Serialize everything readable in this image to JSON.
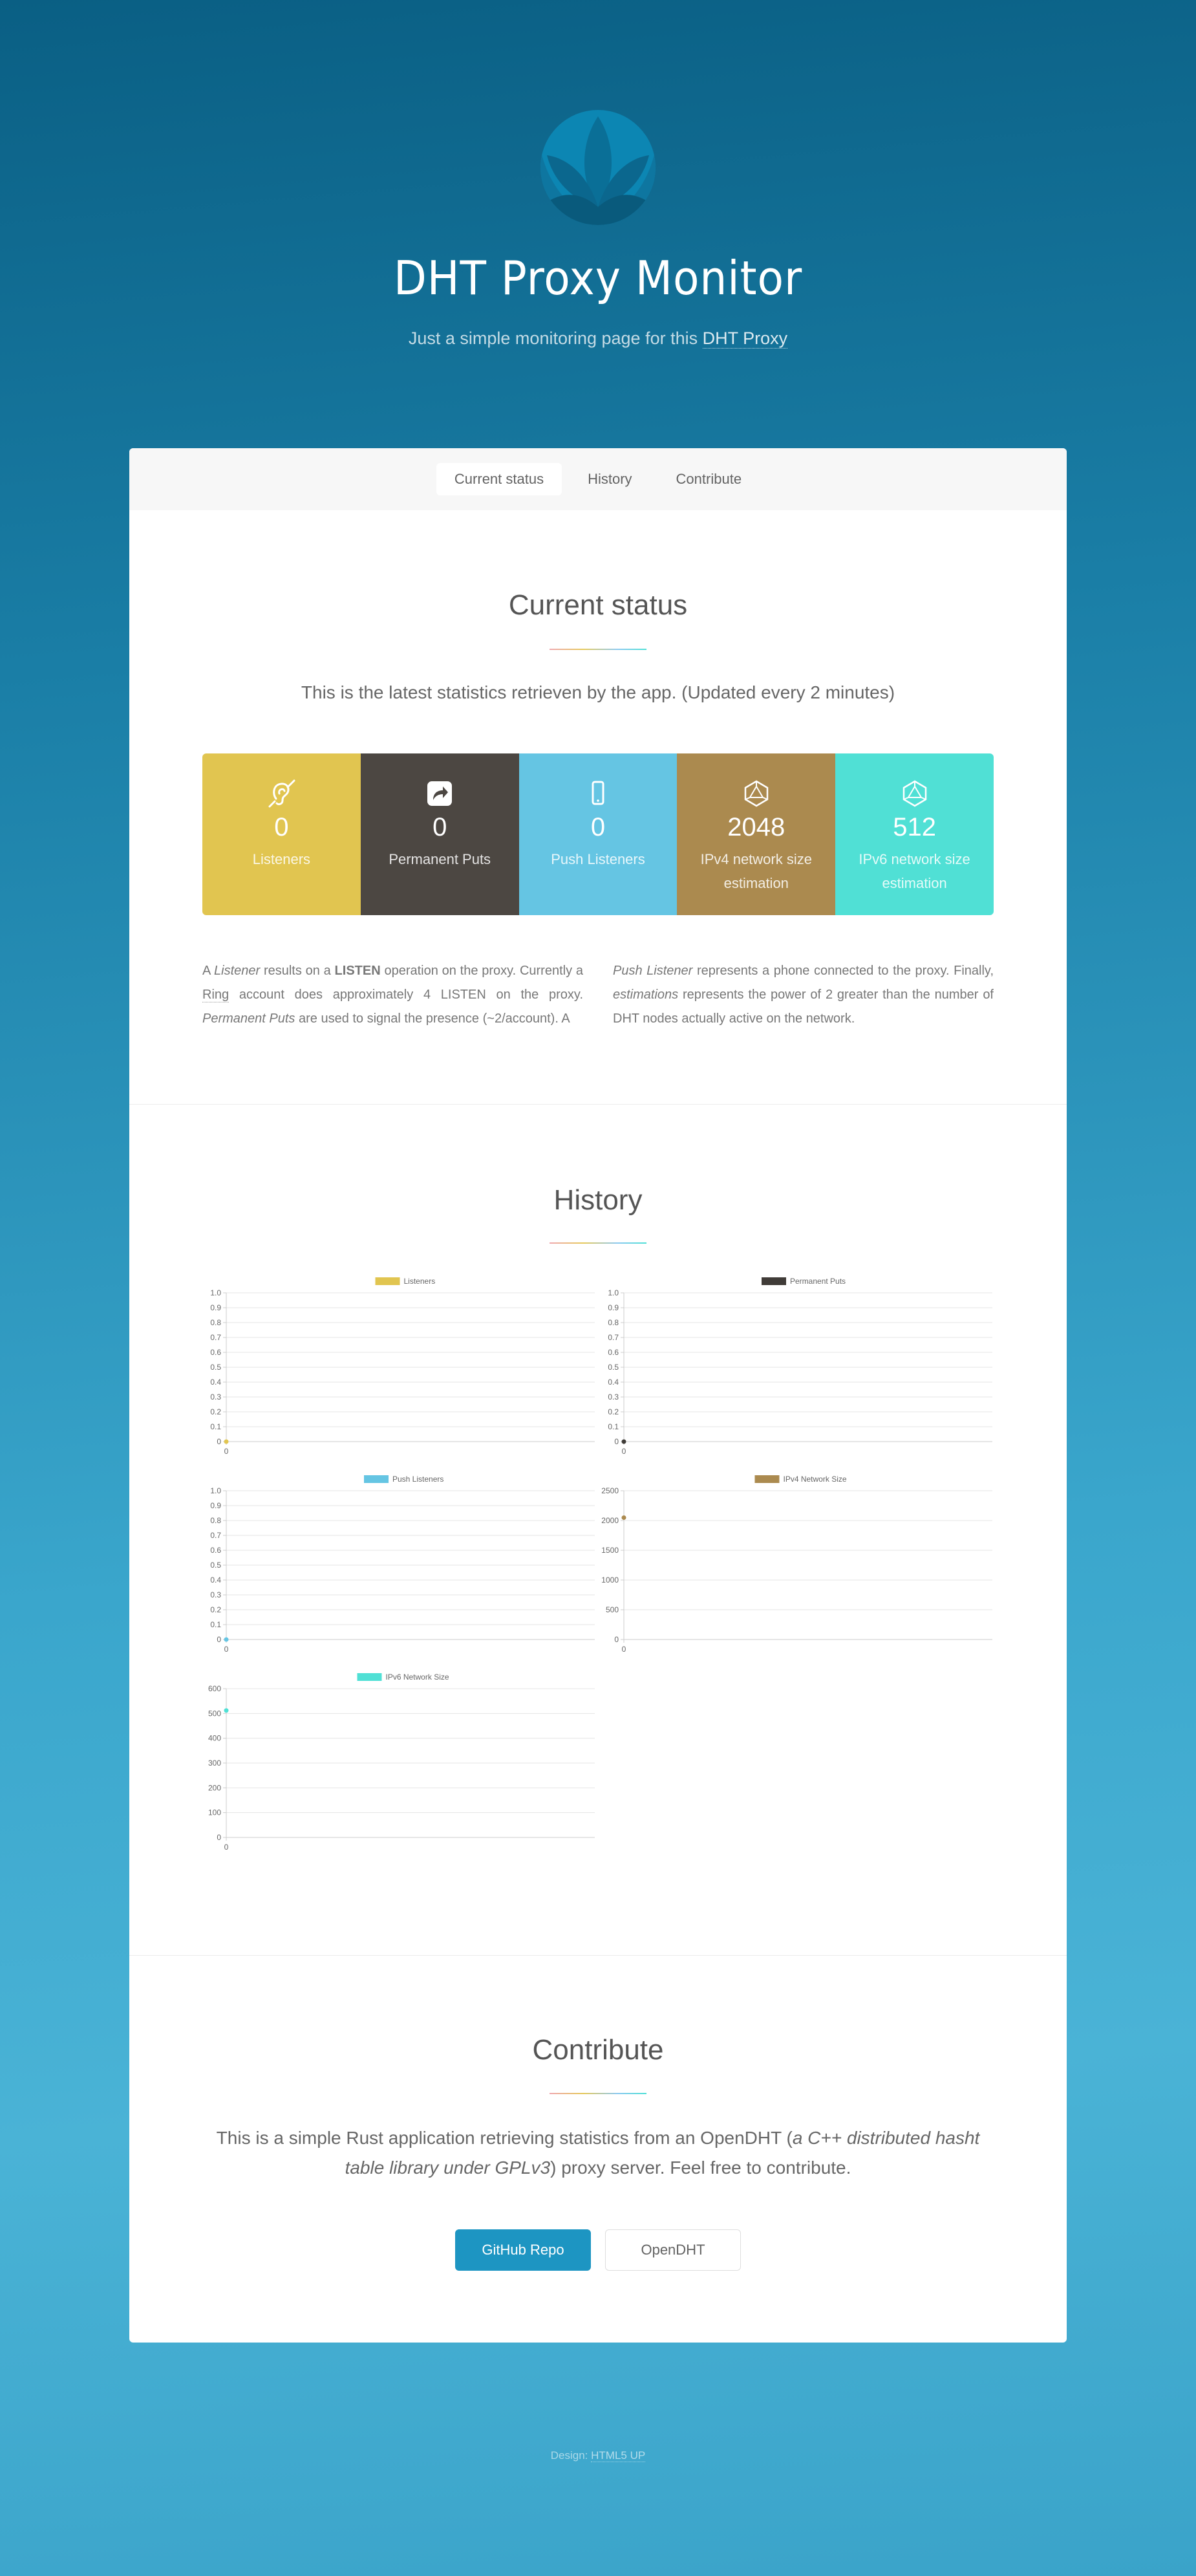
{
  "header": {
    "title": "DHT Proxy Monitor",
    "subtitle_prefix": "Just a simple monitoring page for this ",
    "subtitle_link": "DHT Proxy"
  },
  "nav": {
    "items": [
      {
        "label": "Current status",
        "active": true
      },
      {
        "label": "History",
        "active": false
      },
      {
        "label": "Contribute",
        "active": false
      }
    ]
  },
  "current_status": {
    "title": "Current status",
    "lead": "This is the latest statistics retrieven by the app. (Updated every 2 minutes)",
    "stats": [
      {
        "icon": "deaf-icon",
        "value": "0",
        "label": "Listeners",
        "color": "#e1c550"
      },
      {
        "icon": "share-icon",
        "value": "0",
        "label": "Permanent Puts",
        "color": "#4c4742"
      },
      {
        "icon": "mobile-icon",
        "value": "0",
        "label": "Push Listeners",
        "color": "#65c5e3"
      },
      {
        "icon": "hexagon-icon",
        "value": "2048",
        "label": "IPv4 network size estimation",
        "color": "#ab8a4f"
      },
      {
        "icon": "hexagon-icon",
        "value": "512",
        "label": "IPv6 network size estimation",
        "color": "#50e0d5"
      }
    ],
    "desc_left": {
      "p1": "A ",
      "listener": "Listener",
      "p2": " results on a ",
      "listen": "LISTEN",
      "p3": " operation on the proxy. Currently a ",
      "ring": "Ring",
      "p4": " account does approximately 4 LISTEN on the proxy. ",
      "permanent": "Permanent Puts",
      "p5": " are used to signal the presence (~2/account). A"
    },
    "desc_right": {
      "push": "Push Listener",
      "p1": " represents a phone connected to the proxy. Finally, ",
      "estimations": "estimations",
      "p2": " represents the power of 2 greater than the number of DHT nodes actually active on the network."
    }
  },
  "history": {
    "title": "History"
  },
  "chart_data": [
    {
      "type": "line",
      "series": [
        {
          "name": "Listeners",
          "color": "#e1c550",
          "x": [
            0
          ],
          "values": [
            0
          ]
        }
      ],
      "ylim": [
        0,
        1.0
      ],
      "yticks": [
        "1.0",
        "0.9",
        "0.8",
        "0.7",
        "0.6",
        "0.5",
        "0.4",
        "0.3",
        "0.2",
        "0.1",
        "0"
      ],
      "xticks": [
        "0"
      ],
      "grid": true,
      "legend": "top"
    },
    {
      "type": "line",
      "series": [
        {
          "name": "Permanent Puts",
          "color": "#403c38",
          "x": [
            0
          ],
          "values": [
            0
          ]
        }
      ],
      "ylim": [
        0,
        1.0
      ],
      "yticks": [
        "1.0",
        "0.9",
        "0.8",
        "0.7",
        "0.6",
        "0.5",
        "0.4",
        "0.3",
        "0.2",
        "0.1",
        "0"
      ],
      "xticks": [
        "0"
      ],
      "grid": true,
      "legend": "top"
    },
    {
      "type": "line",
      "series": [
        {
          "name": "Push Listeners",
          "color": "#65c5e3",
          "x": [
            0
          ],
          "values": [
            0
          ]
        }
      ],
      "ylim": [
        0,
        1.0
      ],
      "yticks": [
        "1.0",
        "0.9",
        "0.8",
        "0.7",
        "0.6",
        "0.5",
        "0.4",
        "0.3",
        "0.2",
        "0.1",
        "0"
      ],
      "xticks": [
        "0"
      ],
      "grid": true,
      "legend": "top"
    },
    {
      "type": "line",
      "series": [
        {
          "name": "IPv4 Network Size",
          "color": "#ab8a4f",
          "x": [
            0
          ],
          "values": [
            2048
          ]
        }
      ],
      "ylim": [
        0,
        2500
      ],
      "yticks": [
        "2500",
        "2000",
        "1500",
        "1000",
        "500",
        "0"
      ],
      "xticks": [
        "0"
      ],
      "grid": true,
      "legend": "top"
    },
    {
      "type": "line",
      "series": [
        {
          "name": "IPv6 Network Size",
          "color": "#50e0d5",
          "x": [
            0
          ],
          "values": [
            512
          ]
        }
      ],
      "ylim": [
        0,
        600
      ],
      "yticks": [
        "600",
        "500",
        "400",
        "300",
        "200",
        "100",
        "0"
      ],
      "xticks": [
        "0"
      ],
      "grid": true,
      "legend": "top"
    }
  ],
  "contribute": {
    "title": "Contribute",
    "text_prefix": "This is a simple Rust application retrieving statistics from an OpenDHT (",
    "text_italic": "a C++ distributed hasht table library under GPLv3",
    "text_suffix": ") proxy server. Feel free to contribute.",
    "primary_button": "GitHub Repo",
    "secondary_button": "OpenDHT"
  },
  "footer": {
    "prefix": "Design: ",
    "link": "HTML5 UP"
  }
}
